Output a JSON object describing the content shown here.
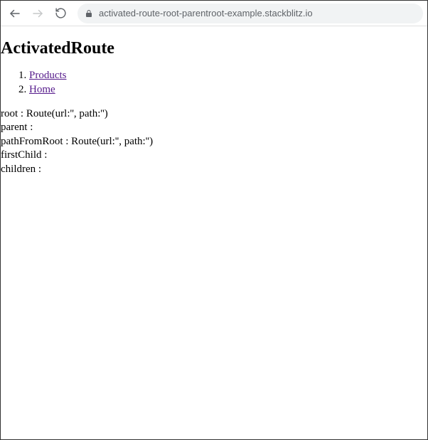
{
  "toolbar": {
    "url": "activated-route-root-parentroot-example.stackblitz.io"
  },
  "page": {
    "title": "ActivatedRoute",
    "nav": [
      {
        "label": "Products"
      },
      {
        "label": "Home"
      }
    ],
    "debug": {
      "root_label": "root : ",
      "root_value": "Route(url:'', path:'')",
      "parent_label": "parent :",
      "parent_value": "",
      "pathFromRoot_label": "pathFromRoot : ",
      "pathFromRoot_value": "Route(url:'', path:'')",
      "firstChild_label": "firstChild :",
      "firstChild_value": "",
      "children_label": "children :",
      "children_value": ""
    }
  }
}
